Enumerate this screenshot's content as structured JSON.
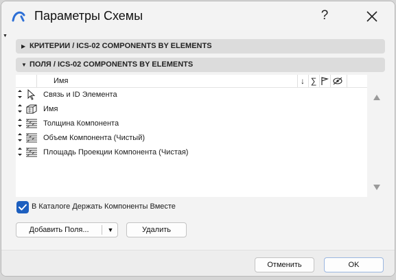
{
  "window": {
    "title": "Параметры Схемы",
    "help_label": "?"
  },
  "sections": {
    "criteria_label": "КРИТЕРИИ / ICS-02 COMPONENTS BY ELEMENTS",
    "fields_label": "ПОЛЯ / ICS-02 COMPONENTS BY ELEMENTS"
  },
  "columns": {
    "name": "Имя",
    "icons": [
      "sort-down-arrow-icon",
      "sum-icon",
      "flag-icon",
      "hide-eye-icon"
    ]
  },
  "fields": [
    {
      "label": "Связь и ID Элемента",
      "icon": "cursor-arrow-icon"
    },
    {
      "label": "Имя",
      "icon": "cube-icon"
    },
    {
      "label": "Толщина Компонента",
      "icon": "hatch-component-icon"
    },
    {
      "label": "Объем Компонента (Чистый)",
      "icon": "hatch-component-icon"
    },
    {
      "label": "Площадь Проекции Компонента (Чистая)",
      "icon": "hatch-component-icon"
    }
  ],
  "keep_components_together": {
    "label": "В Каталоге Держать Компоненты Вместе",
    "checked": true
  },
  "buttons": {
    "add_fields": "Добавить Поля...",
    "delete": "Удалить",
    "cancel": "Отменить",
    "ok": "OK"
  },
  "colors": {
    "accent": "#1d5fbf",
    "section_bg": "#dcdcdc",
    "dialog_bg": "#f3f3f3"
  }
}
